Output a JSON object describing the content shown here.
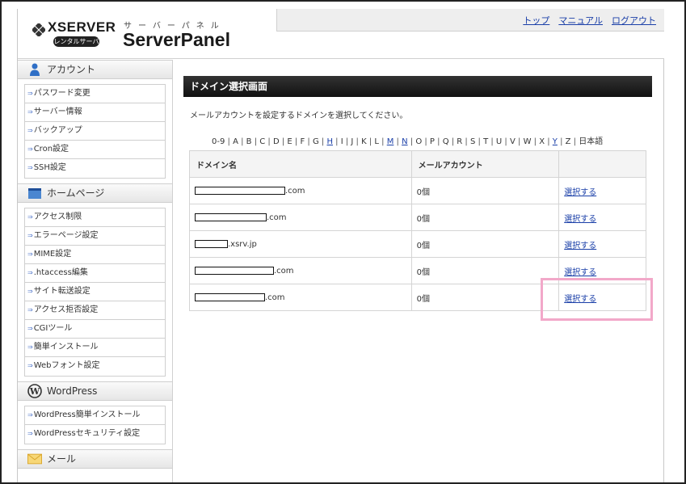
{
  "header": {
    "brand": "XSERVER",
    "badge": "レンタルサーバー",
    "panel_small": "サーバーパネル",
    "panel_title": "ServerPanel",
    "nav": [
      "トップ",
      "マニュアル",
      "ログアウト"
    ]
  },
  "sidebar": {
    "sections": [
      {
        "title": "アカウント",
        "icon": "person-icon",
        "items": [
          "パスワード変更",
          "サーバー情報",
          "バックアップ",
          "Cron設定",
          "SSH設定"
        ]
      },
      {
        "title": "ホームページ",
        "icon": "homepage-icon",
        "items": [
          "アクセス制限",
          "エラーページ設定",
          "MIME設定",
          ".htaccess編集",
          "サイト転送設定",
          "アクセス拒否設定",
          "CGIツール",
          "簡単インストール",
          "Webフォント設定"
        ]
      },
      {
        "title": "WordPress",
        "icon": "wordpress-icon",
        "items": [
          "WordPress簡単インストール",
          "WordPressセキュリティ設定"
        ]
      },
      {
        "title": "メール",
        "icon": "mail-icon",
        "items": []
      }
    ]
  },
  "main": {
    "title": "ドメイン選択画面",
    "description": "メールアカウントを設定するドメインを選択してください。",
    "alpha_index": [
      {
        "t": "0-9",
        "link": false
      },
      {
        "t": "A",
        "link": false
      },
      {
        "t": "B",
        "link": false
      },
      {
        "t": "C",
        "link": false
      },
      {
        "t": "D",
        "link": false
      },
      {
        "t": "E",
        "link": false
      },
      {
        "t": "F",
        "link": false
      },
      {
        "t": "G",
        "link": false
      },
      {
        "t": "H",
        "link": true
      },
      {
        "t": "I",
        "link": false
      },
      {
        "t": "J",
        "link": false
      },
      {
        "t": "K",
        "link": false
      },
      {
        "t": "L",
        "link": false
      },
      {
        "t": "M",
        "link": true
      },
      {
        "t": "N",
        "link": true
      },
      {
        "t": "O",
        "link": false
      },
      {
        "t": "P",
        "link": false
      },
      {
        "t": "Q",
        "link": false
      },
      {
        "t": "R",
        "link": false
      },
      {
        "t": "S",
        "link": false
      },
      {
        "t": "T",
        "link": false
      },
      {
        "t": "U",
        "link": false
      },
      {
        "t": "V",
        "link": false
      },
      {
        "t": "W",
        "link": false
      },
      {
        "t": "X",
        "link": false
      },
      {
        "t": "Y",
        "link": true
      },
      {
        "t": "Z",
        "link": false
      },
      {
        "t": "日本語",
        "link": false
      }
    ],
    "table": {
      "headers": [
        "ドメイン名",
        "メールアカウント",
        ""
      ],
      "rows": [
        {
          "domain_suffix": ".com",
          "count": "0個",
          "action": "選択する"
        },
        {
          "domain_suffix": ".com",
          "count": "0個",
          "action": "選択する"
        },
        {
          "domain_suffix": ".xsrv.jp",
          "count": "0個",
          "action": "選択する"
        },
        {
          "domain_suffix": ".com",
          "count": "0個",
          "action": "選択する"
        },
        {
          "domain_suffix": ".com",
          "count": "0個",
          "action": "選択する"
        }
      ]
    }
  },
  "colors": {
    "link": "#1a3fa8",
    "title_bar": "#222222",
    "highlight": "#f2a8c9"
  }
}
